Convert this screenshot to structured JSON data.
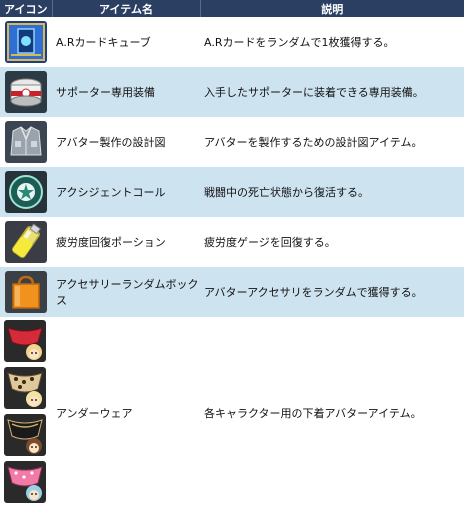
{
  "header": {
    "col_icon": "アイコン",
    "col_name": "アイテム名",
    "col_desc": "説明"
  },
  "items": [
    {
      "name": "A.Rカードキューブ",
      "desc": "A.Rカードをランダムで1枚獲得する。",
      "icon": "card-cube-icon"
    },
    {
      "name": "サポーター専用装備",
      "desc": "入手したサポーターに装着できる専用装備。",
      "icon": "supporter-equipment-icon"
    },
    {
      "name": "アバター製作の設計図",
      "desc": "アバターを製作するための設計図アイテム。",
      "icon": "avatar-blueprint-icon"
    },
    {
      "name": "アクシジェントコール",
      "desc": "戦闘中の死亡状態から復活する。",
      "icon": "accident-call-icon"
    },
    {
      "name": "疲労度回復ポーション",
      "desc": "疲労度ゲージを回復する。",
      "icon": "fatigue-potion-icon"
    },
    {
      "name": "アクセサリーランダムボックス",
      "desc": "アバターアクセサリをランダムで獲得する。",
      "icon": "accessory-box-icon"
    },
    {
      "name": "アンダーウェア",
      "desc": "各キャラクター用の下着アバターアイテム。",
      "icon": "underwear-icon"
    }
  ],
  "colors": {
    "header_bg": "#2b3f63",
    "row_alt": "#cde3ef"
  }
}
